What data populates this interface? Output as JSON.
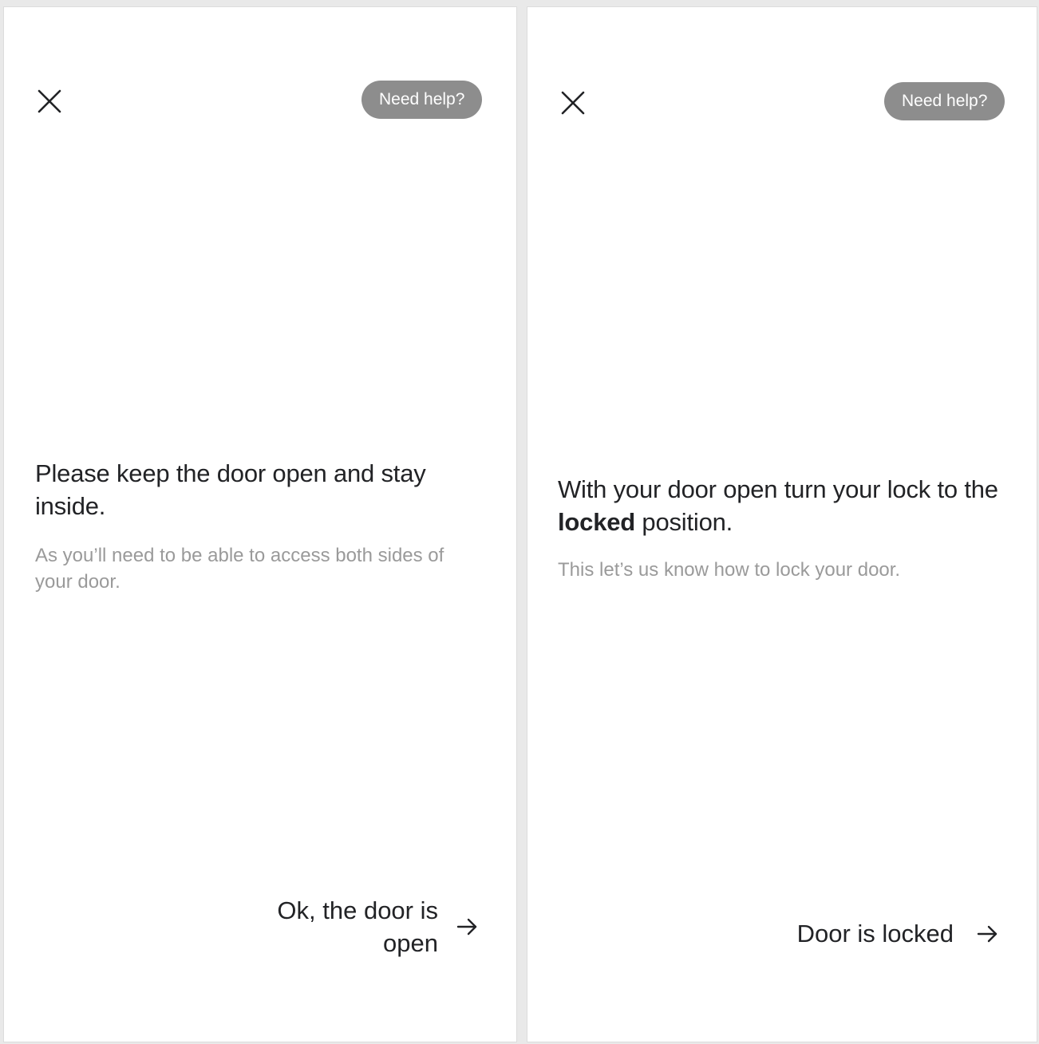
{
  "screens": [
    {
      "close_icon": "close-icon",
      "help_label": "Need help?",
      "headline": "Please keep the door open and stay inside.",
      "subtext": "As you’ll need to be able to access both sides of your door.",
      "cta_line1": "Ok, the door is",
      "cta_line2": "open",
      "cta_icon": "arrow-right-icon"
    },
    {
      "close_icon": "close-icon",
      "help_label": "Need help?",
      "headline_before": "With your door open turn your lock to the ",
      "headline_bold": "locked",
      "headline_after": " position.",
      "subtext": "This let’s us know how to lock your door.",
      "cta_label": "Door is locked",
      "cta_icon": "arrow-right-icon"
    }
  ],
  "colors": {
    "text_primary": "#222326",
    "text_secondary": "#9a9a9a",
    "help_button_bg": "#8d8d8d",
    "background": "#ffffff"
  }
}
